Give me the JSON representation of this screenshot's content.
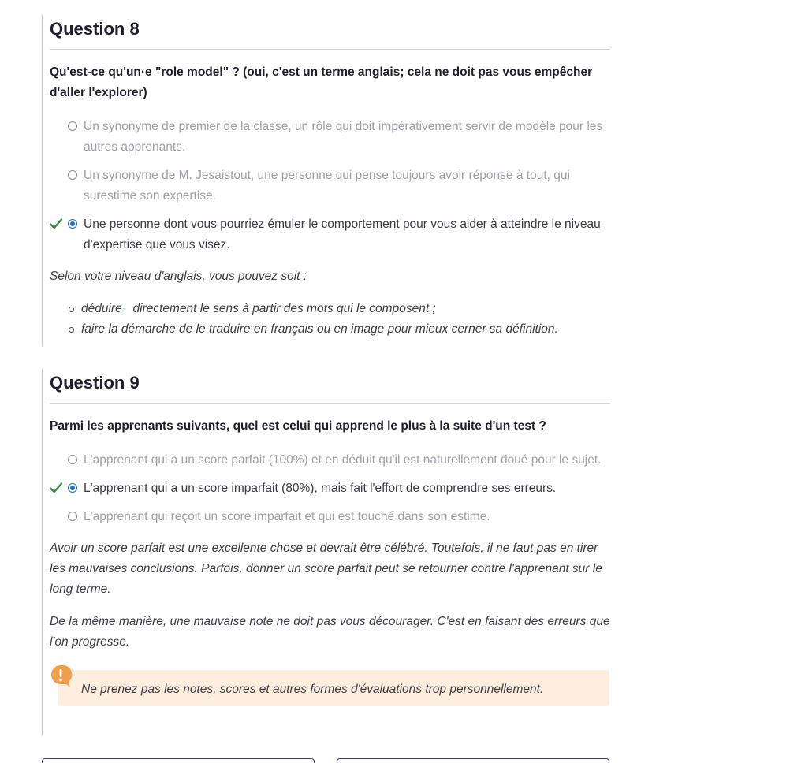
{
  "q8": {
    "title": "Question 8",
    "text": "Qu'est-ce qu'un·e \"role model\" ? (oui, c'est un terme anglais; cela ne doit pas vous empêcher d'aller l'explorer)",
    "answers": [
      {
        "label": "Un synonyme de premier de la classe, un rôle qui doit impérativement servir de modèle pour les autres apprenants.",
        "selected": false,
        "correct": false
      },
      {
        "label": "Un synonyme de M. Jesaistout, une personne qui pense toujours avoir réponse à tout, qui surestime son expertise.",
        "selected": false,
        "correct": false
      },
      {
        "label": "Une personne dont vous pourriez émuler le comportement pour vous aider à atteindre le niveau d'expertise que vous visez.",
        "selected": true,
        "correct": true
      }
    ],
    "feedback_intro": "Selon votre niveau d'anglais, vous pouvez soit :",
    "bullet1_a": "déduire",
    "bullet1_b": "-",
    "bullet1_c": "  directement le sens à partir des mots qui le composent ;",
    "bullet2": "faire la démarche de le traduire en français ou en image pour mieux cerner sa définition."
  },
  "q9": {
    "title": "Question 9",
    "text": "Parmi les apprenants suivants, quel est celui qui apprend le plus à la suite d'un test ?",
    "answers": [
      {
        "label": "L'apprenant qui a un score parfait (100%) et en déduit qu'il est naturellement doué pour le sujet.",
        "selected": false,
        "correct": false
      },
      {
        "label": "L'apprenant qui a un score imparfait (80%), mais fait l'effort de comprendre ses erreurs.",
        "selected": true,
        "correct": true
      },
      {
        "label": "L'apprenant qui reçoit un score imparfait et qui est touché dans son estime.",
        "selected": false,
        "correct": false
      }
    ],
    "feedback_p1": "Avoir un score parfait est une excellente chose et devrait être célébré. Toutefois, il ne faut pas en tirer les mauvaises conclusions. Parfois, donner un score parfait peut se retourner contre l'apprenant sur le long terme.",
    "feedback_p2": "De la même manière, une mauvaise note ne doit pas vous décourager. C'est en faisant des erreurs que l'on progresse.",
    "note": "Ne prenez pas les notes, scores et autres formes d'évaluations trop personnellement."
  },
  "colors": {
    "correct_check": "#2e8b3e",
    "radio_selected": "#1a6fd8",
    "note_background": "#fdeee0",
    "warning_icon": "#f0a04b"
  },
  "icons": {
    "check": "check-icon",
    "warning": "exclamation-icon"
  }
}
